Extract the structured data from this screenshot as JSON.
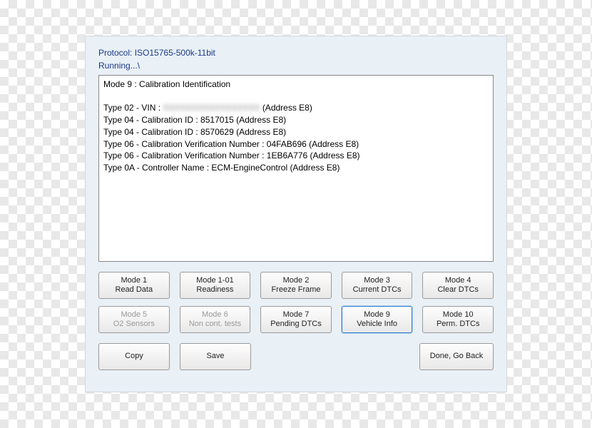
{
  "header": {
    "protocol_label": "Protocol:",
    "protocol_value": "ISO15765-500k-11bit",
    "status": "Running...\\"
  },
  "output": {
    "title": "Mode 9 : Calibration Identification",
    "lines": [
      "Type 02 - VIN :",
      "Type 04 - Calibration ID : 8517015 (Address E8)",
      "Type 04 - Calibration ID : 8570629 (Address E8)",
      "Type 06 - Calibration Verification Number : 04FAB696 (Address E8)",
      "Type 06 - Calibration Verification Number : 1EB6A776 (Address E8)",
      "Type 0A - Controller Name : ECM-EngineControl (Address E8)"
    ],
    "vin_redacted_placeholder": "XXXXXXXXXXXXXXXXX",
    "vin_suffix": "(Address E8)"
  },
  "buttons": {
    "mode1": {
      "line1": "Mode 1",
      "line2": "Read Data"
    },
    "mode1_01": {
      "line1": "Mode 1-01",
      "line2": "Readiness"
    },
    "mode2": {
      "line1": "Mode 2",
      "line2": "Freeze Frame"
    },
    "mode3": {
      "line1": "Mode 3",
      "line2": "Current DTCs"
    },
    "mode4": {
      "line1": "Mode 4",
      "line2": "Clear DTCs"
    },
    "mode5": {
      "line1": "Mode 5",
      "line2": "O2 Sensors"
    },
    "mode6": {
      "line1": "Mode 6",
      "line2": "Non cont. tests"
    },
    "mode7": {
      "line1": "Mode 7",
      "line2": "Pending DTCs"
    },
    "mode9": {
      "line1": "Mode 9",
      "line2": "Vehicle Info"
    },
    "mode10": {
      "line1": "Mode 10",
      "line2": "Perm. DTCs"
    },
    "copy": "Copy",
    "save": "Save",
    "done": "Done, Go Back"
  }
}
